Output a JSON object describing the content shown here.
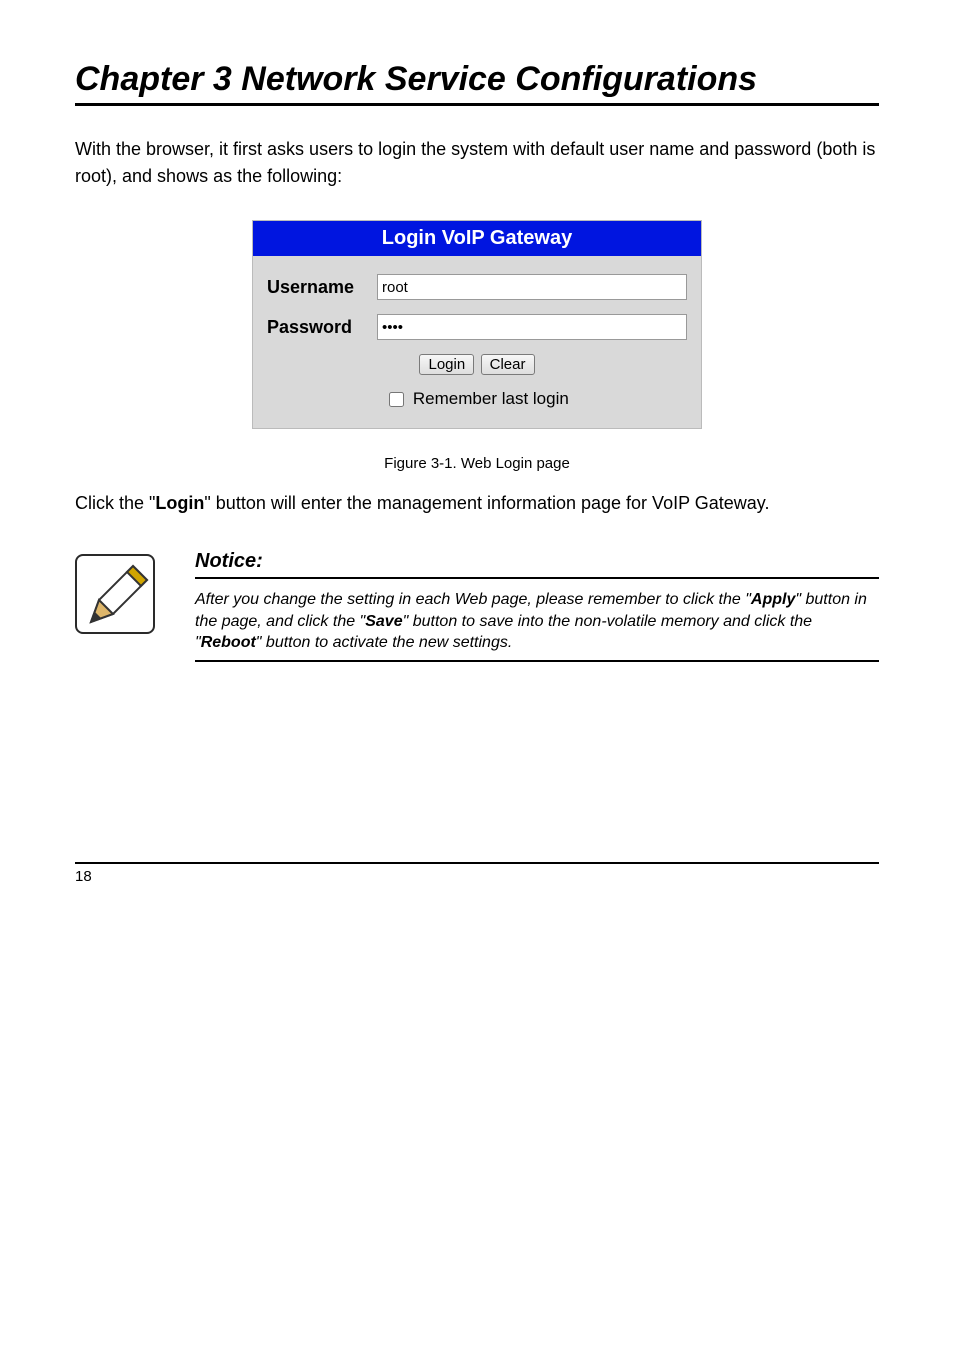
{
  "chapter_title": "Chapter 3 Network Service Configurations",
  "intro_text": "With the browser, it first asks users to login the system with default user name and password (both is root), and shows as the following:",
  "login_box": {
    "header": "Login VoIP Gateway",
    "username_label": "Username",
    "username_value": "root",
    "password_label": "Password",
    "password_value": "••••",
    "login_btn": "Login",
    "clear_btn": "Clear",
    "remember_label": "Remember last login"
  },
  "caption": "Figure 3-1. Web Login page",
  "para2_a": "Click the \"",
  "para2_login": "Login",
  "para2_b": "\" button will enter the management information page for VoIP Gateway.",
  "note": {
    "heading": "Notice:",
    "line1_a": "After you change the setting in each Web page, please remember to click the \"",
    "line1_apply": "Apply",
    "line1_b": "\" button in the page, and click the \"",
    "line1_save": "Save",
    "line1_c": "\" button to save into the non-volatile memory and click the \"",
    "line1_reboot": "Reboot",
    "line1_d": "\" button to activate the new settings."
  },
  "page_number": "18"
}
